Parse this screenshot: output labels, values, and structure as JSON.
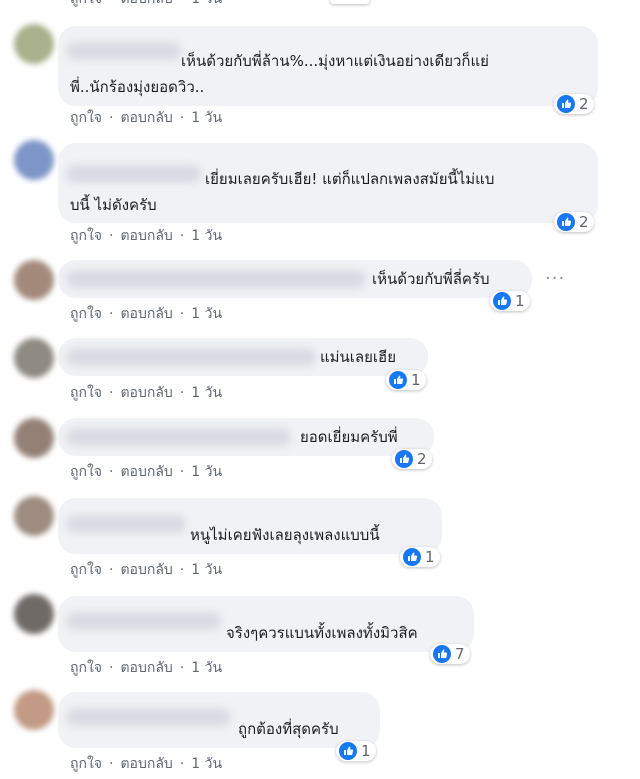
{
  "actions": {
    "like": "ถูกใจ",
    "reply": "ตอบกลับ",
    "time": "1 วัน",
    "separator": "·"
  },
  "comments": [
    {
      "text": "เห็นด้วยกับพี่ล้าน%...มุ่งหาแต่เงินอย่างเดียวก็แย่\nพี่..นักร้องมุ่งยอดวิว..",
      "reactions": "2",
      "avatar_color": "#a8b08c"
    },
    {
      "text": "เยี่ยมเลยครับเฮีย! แต่ก็แปลกเพลงสมัยนี้ไม่แบ\nบนี้ ไม่ดังครับ",
      "reactions": "2",
      "avatar_color": "#7d95c8"
    },
    {
      "text": "เห็นด้วยกับพี่ลี่ครับ",
      "reactions": "1",
      "avatar_color": "#a3897a"
    },
    {
      "text": "แม่นเลยเฮีย",
      "reactions": "1",
      "avatar_color": "#8f8a82"
    },
    {
      "text": "ยอดเยี่ยมครับพี่",
      "reactions": "2",
      "avatar_color": "#948176"
    },
    {
      "text": "หนูไม่เคยฟังเลยลุงเพลงแบบนี้",
      "reactions": "1",
      "avatar_color": "#9d8c7f"
    },
    {
      "text": "จริงๆควรแบนทั้งเพลงทั้งมิวสิค",
      "reactions": "7",
      "avatar_color": "#6f6a66"
    },
    {
      "text": "ถูกต้องที่สุดครับ",
      "reactions": "1",
      "avatar_color": "#c29a85"
    }
  ],
  "colors": {
    "like_blue": "#1877f2",
    "bubble": "#f0f2f5",
    "meta_text": "#606770"
  },
  "icons": {
    "like": "thumbs-up-icon",
    "more": "more-options-icon"
  }
}
